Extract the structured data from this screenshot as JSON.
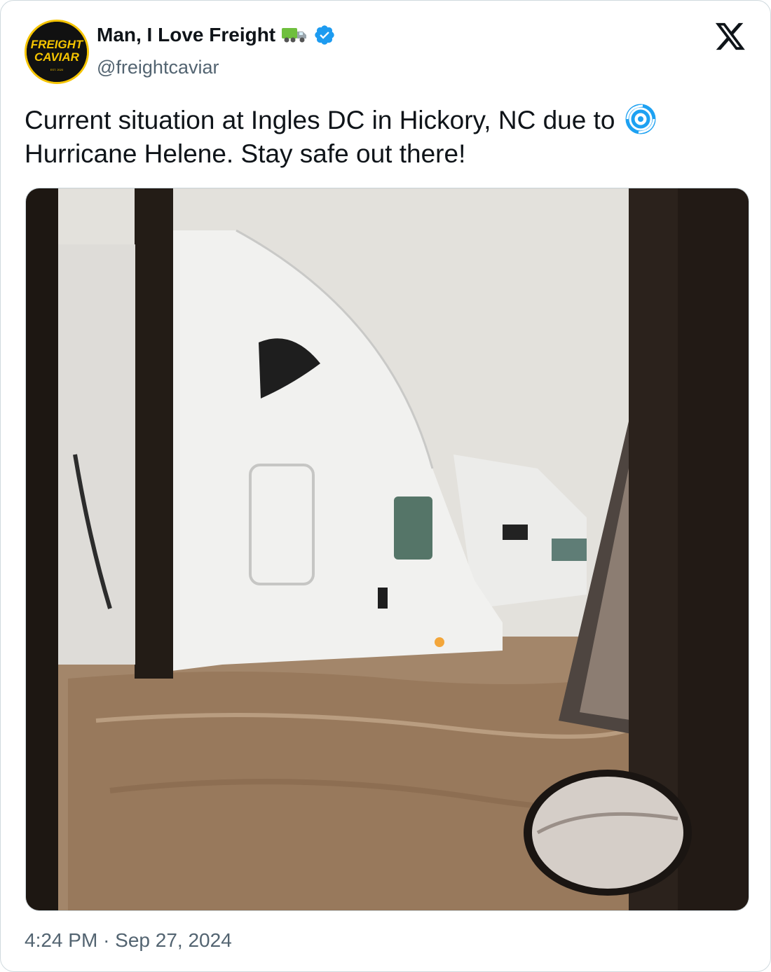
{
  "author": {
    "display_name": "Man, I Love Freight",
    "display_name_emoji": "truck-emoji",
    "verified_badge": "verified-check-icon",
    "handle": "@freightcaviar",
    "avatar": {
      "line1": "FREIGHT",
      "line2": "CAVIAR",
      "est": "EST. 2020",
      "ring_color": "#f5c400",
      "text_color": "#f5c400",
      "bg_color": "#111111"
    }
  },
  "platform_logo": "x-logo-icon",
  "tweet": {
    "text_before_emoji": "Current situation at Ingles DC in Hickory, NC due to",
    "emoji": "cyclone-emoji",
    "text_after_emoji": "Hurricane Helene. Stay safe out there!"
  },
  "media": {
    "kind": "photo",
    "subject": "white semi trucks in brown floodwater"
  },
  "timestamp": {
    "time": "4:24 PM",
    "separator": "·",
    "date": "Sep 27, 2024"
  },
  "colors": {
    "text_primary": "#0f1419",
    "text_secondary": "#536471",
    "verified_blue": "#1d9bf0",
    "border": "#cfd9de",
    "cyclone_blue": "#1da1f2"
  }
}
